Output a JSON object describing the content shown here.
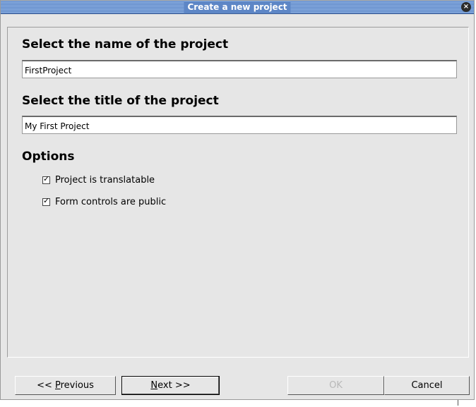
{
  "window": {
    "title": "Create a new project"
  },
  "close_icon": "×",
  "project_name": {
    "label": "Select the name of the project",
    "value": "FirstProject"
  },
  "project_title": {
    "label": "Select the title of the project",
    "value": "My First Project"
  },
  "options": {
    "label": "Options",
    "items": [
      {
        "label": "Project is translatable",
        "checked": true
      },
      {
        "label": "Form controls are public",
        "checked": true
      }
    ]
  },
  "buttons": {
    "previous": {
      "prefix": "<< ",
      "key": "P",
      "rest": "revious"
    },
    "next": {
      "prefix": "",
      "key": "N",
      "rest": "ext >>"
    },
    "ok": "OK",
    "cancel": "Cancel"
  }
}
